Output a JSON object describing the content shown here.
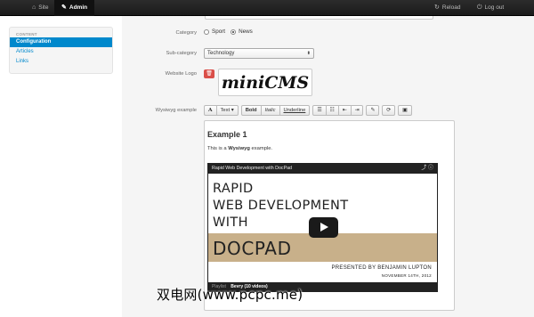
{
  "navbar": {
    "items": [
      {
        "icon": "home-icon",
        "glyph": "⌂",
        "label": "Site"
      },
      {
        "icon": "pencil-icon",
        "glyph": "✎",
        "label": "Admin"
      },
      {
        "icon": "refresh-icon",
        "glyph": "↻",
        "label": "Reload"
      },
      {
        "icon": "logout-icon",
        "glyph": "⏻",
        "label": "Log out"
      }
    ]
  },
  "sidebar": {
    "header": "CONTENT",
    "items": [
      {
        "label": "Configuration"
      },
      {
        "label": "Articles"
      },
      {
        "label": "Links"
      }
    ]
  },
  "form": {
    "category": {
      "label": "Category",
      "options": [
        "Sport",
        "News"
      ],
      "selected": "News"
    },
    "subcategory": {
      "label": "Sub-category",
      "value": "Technology"
    },
    "website_logo": {
      "label": "Website Logo",
      "delete_glyph": "🗑",
      "logo_text": "miniCMS"
    },
    "wysiwyg": {
      "label": "Wysiwyg example",
      "toolbar": {
        "font_glyph": "A",
        "text_label": "Text",
        "dropdown_glyph": "▾",
        "bold": "Bold",
        "italic": "Italic",
        "underline": "Underline",
        "ul_glyph": "☰",
        "ol_glyph": "☷",
        "outdent_glyph": "⇤",
        "indent_glyph": "⇥",
        "pencil_glyph": "✎",
        "undo_glyph": "⟳",
        "image_glyph": "▣"
      },
      "content": {
        "heading": "Example 1",
        "para_prefix": "This is a ",
        "para_bold": "Wysiwyg",
        "para_suffix": " example.",
        "video": {
          "title": "Rapid Web Development with DocPad",
          "icons": "⤴ ⓘ",
          "line1": "RAPID",
          "line2": "WEB DEVELOPMENT",
          "line3": "WITH",
          "line4": "DOCPAD",
          "presenter": "PRESENTED BY BENJAMIN LUPTON",
          "date": "NOVEMBER 14TH, 2012",
          "playlist_label": "Playlist",
          "playlist_name": "Bevry (10 videos)"
        }
      }
    }
  },
  "watermark": "双电网(www.pcpc.me)"
}
